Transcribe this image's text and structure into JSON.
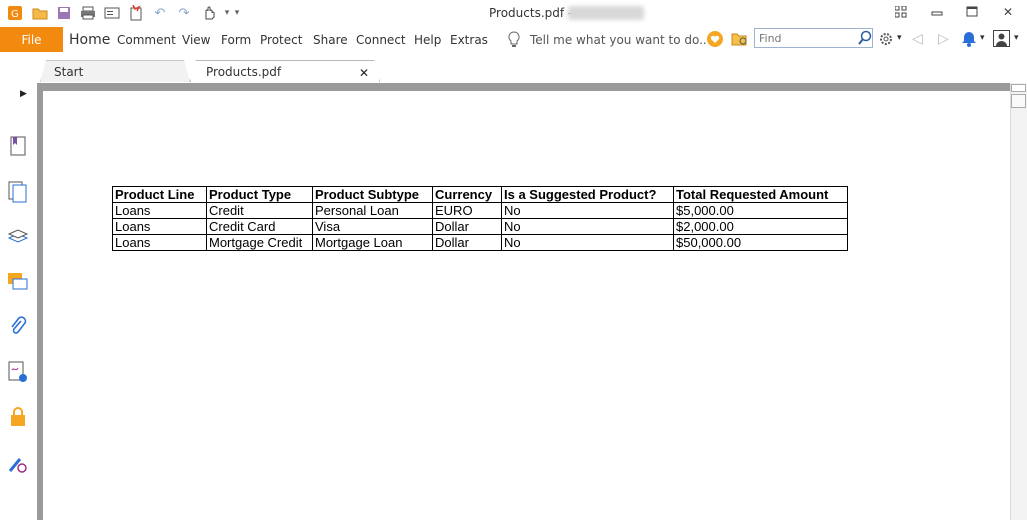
{
  "window": {
    "title": "Products.pdf - ",
    "controls": [
      "restore-layout-icon",
      "minimize-icon",
      "maximize-icon",
      "close-icon"
    ]
  },
  "quick_access": [
    "app-logo-icon",
    "open-icon",
    "save-icon",
    "print-icon",
    "email-icon",
    "new-icon",
    "undo-icon",
    "redo-icon",
    "hand-tool-icon",
    "customize-icon"
  ],
  "menu": {
    "file": "File",
    "items": [
      "Home",
      "Comment",
      "View",
      "Form",
      "Protect",
      "Share",
      "Connect",
      "Help",
      "Extras"
    ],
    "tell_me": "Tell me what you want to do..",
    "find_placeholder": "Find"
  },
  "tabs": [
    {
      "label": "Start",
      "active": false
    },
    {
      "label": "Products.pdf",
      "active": true
    }
  ],
  "sidebar": [
    "bookmark-icon",
    "pages-icon",
    "layers-icon",
    "comments-icon",
    "attachments-icon",
    "signatures-icon",
    "security-icon",
    "certificate-icon"
  ],
  "table": {
    "headers": [
      "Product Line",
      "Product Type",
      "Product Subtype",
      "Currency",
      "Is a Suggested Product?",
      "Total Requested Amount"
    ],
    "rows": [
      [
        "Loans",
        "Credit",
        "Personal Loan",
        "EURO",
        "No",
        "$5,000.00"
      ],
      [
        "Loans",
        "Credit Card",
        "Visa",
        "Dollar",
        "No",
        "$2,000.00"
      ],
      [
        "Loans",
        "Mortgage Credit",
        "Mortgage Loan",
        "Dollar",
        "No",
        "$50,000.00"
      ]
    ]
  },
  "colors": {
    "accent": "#f28a10",
    "frame": "#9a9a9a"
  }
}
